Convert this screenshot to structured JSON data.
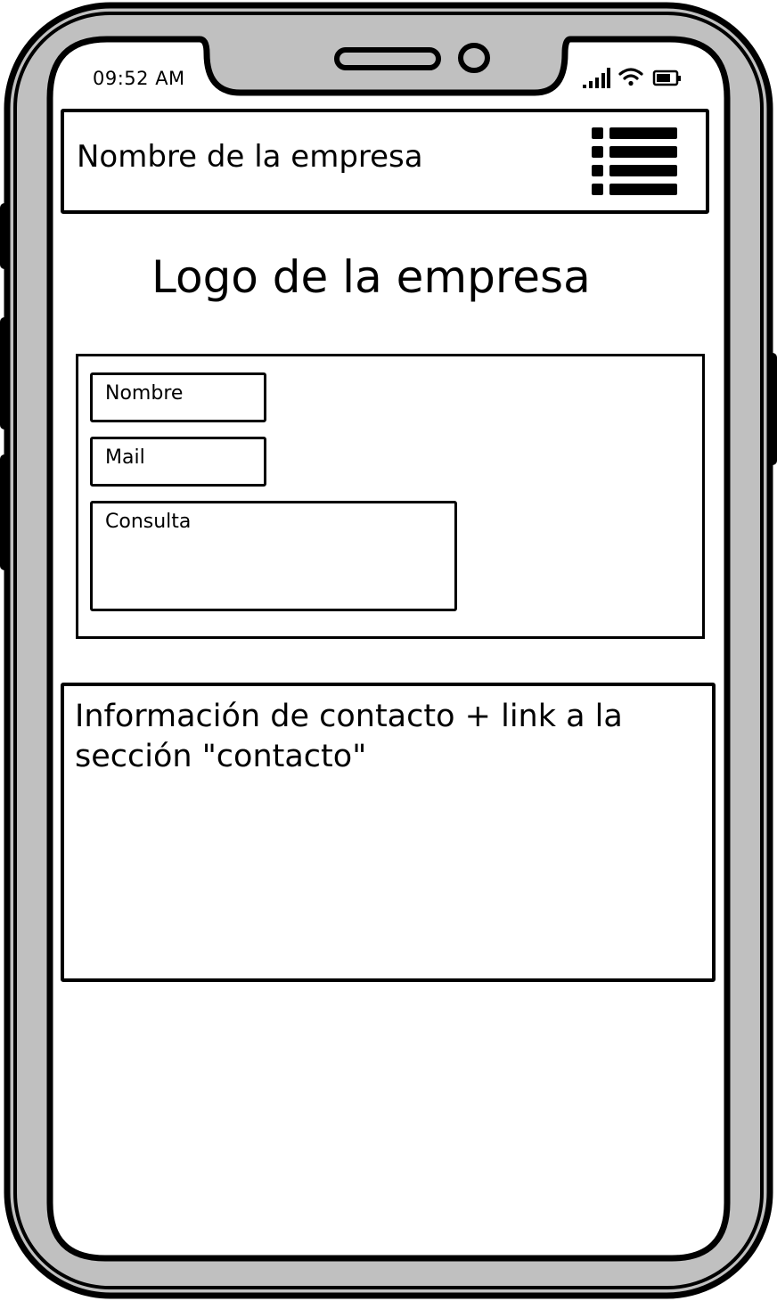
{
  "status_bar": {
    "time": "09:52 AM",
    "icons": [
      "signal-icon",
      "wifi-icon",
      "battery-icon"
    ]
  },
  "header": {
    "company_name": "Nombre de la empresa",
    "menu_icon": "menu-list-icon"
  },
  "logo": {
    "text": "Logo de la empresa"
  },
  "form": {
    "fields": [
      {
        "label": "Nombre"
      },
      {
        "label": "Mail"
      },
      {
        "label": "Consulta"
      }
    ]
  },
  "contact_info": {
    "text": "Información de contacto + link a la sección \"contacto\""
  }
}
